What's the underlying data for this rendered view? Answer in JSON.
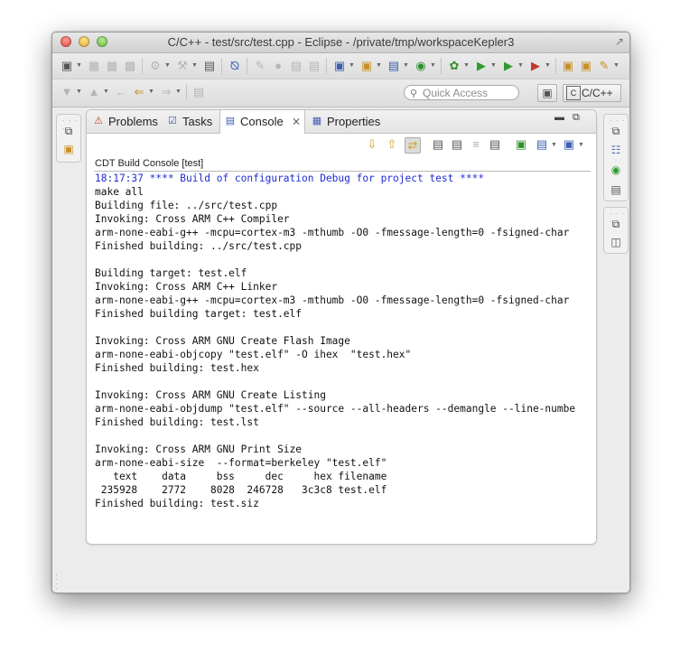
{
  "window": {
    "title": "C/C++ - test/src/test.cpp - Eclipse - /private/tmp/workspaceKepler3"
  },
  "toolbar": {
    "quick_access_placeholder": "Quick Access",
    "perspective_label": "C/C++"
  },
  "tabs": [
    {
      "label": "Problems",
      "icon": "problems-icon"
    },
    {
      "label": "Tasks",
      "icon": "tasks-icon"
    },
    {
      "label": "Console",
      "icon": "console-icon",
      "active": true
    },
    {
      "label": "Properties",
      "icon": "properties-icon"
    }
  ],
  "console": {
    "title": "CDT Build Console [test]",
    "lines": [
      {
        "text": "18:17:37 **** Build of configuration Debug for project test ****",
        "color": "#1f2bd6"
      },
      {
        "text": "make all"
      },
      {
        "text": "Building file: ../src/test.cpp"
      },
      {
        "text": "Invoking: Cross ARM C++ Compiler"
      },
      {
        "text": "arm-none-eabi-g++ -mcpu=cortex-m3 -mthumb -O0 -fmessage-length=0 -fsigned-char"
      },
      {
        "text": "Finished building: ../src/test.cpp"
      },
      {
        "text": ""
      },
      {
        "text": "Building target: test.elf"
      },
      {
        "text": "Invoking: Cross ARM C++ Linker"
      },
      {
        "text": "arm-none-eabi-g++ -mcpu=cortex-m3 -mthumb -O0 -fmessage-length=0 -fsigned-char"
      },
      {
        "text": "Finished building target: test.elf"
      },
      {
        "text": ""
      },
      {
        "text": "Invoking: Cross ARM GNU Create Flash Image"
      },
      {
        "text": "arm-none-eabi-objcopy \"test.elf\" -O ihex  \"test.hex\""
      },
      {
        "text": "Finished building: test.hex"
      },
      {
        "text": ""
      },
      {
        "text": "Invoking: Cross ARM GNU Create Listing"
      },
      {
        "text": "arm-none-eabi-objdump \"test.elf\" --source --all-headers --demangle --line-numbe"
      },
      {
        "text": "Finished building: test.lst"
      },
      {
        "text": ""
      },
      {
        "text": "Invoking: Cross ARM GNU Print Size"
      },
      {
        "text": "arm-none-eabi-size  --format=berkeley \"test.elf\""
      },
      {
        "text": "   text    data     bss     dec     hex filename"
      },
      {
        "text": " 235928    2772    8028  246728   3c3c8 test.elf"
      },
      {
        "text": "Finished building: test.siz"
      }
    ]
  }
}
